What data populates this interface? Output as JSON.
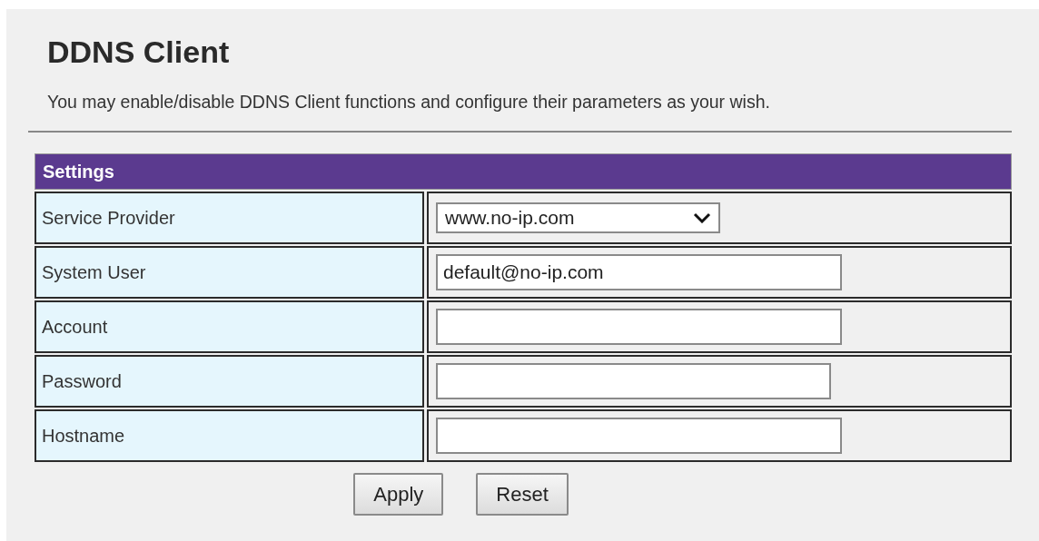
{
  "title": "DDNS Client",
  "description": "You may enable/disable DDNS Client functions and configure their parameters as your wish.",
  "settings": {
    "header": "Settings",
    "rows": [
      {
        "label": "Service Provider",
        "kind": "select",
        "value": "www.no-ip.com"
      },
      {
        "label": "System User",
        "kind": "text",
        "value": "default@no-ip.com"
      },
      {
        "label": "Account",
        "kind": "text"
      },
      {
        "label": "Password",
        "kind": "password"
      },
      {
        "label": "Hostname",
        "kind": "text"
      }
    ]
  },
  "buttons": [
    "Apply",
    "Reset"
  ]
}
